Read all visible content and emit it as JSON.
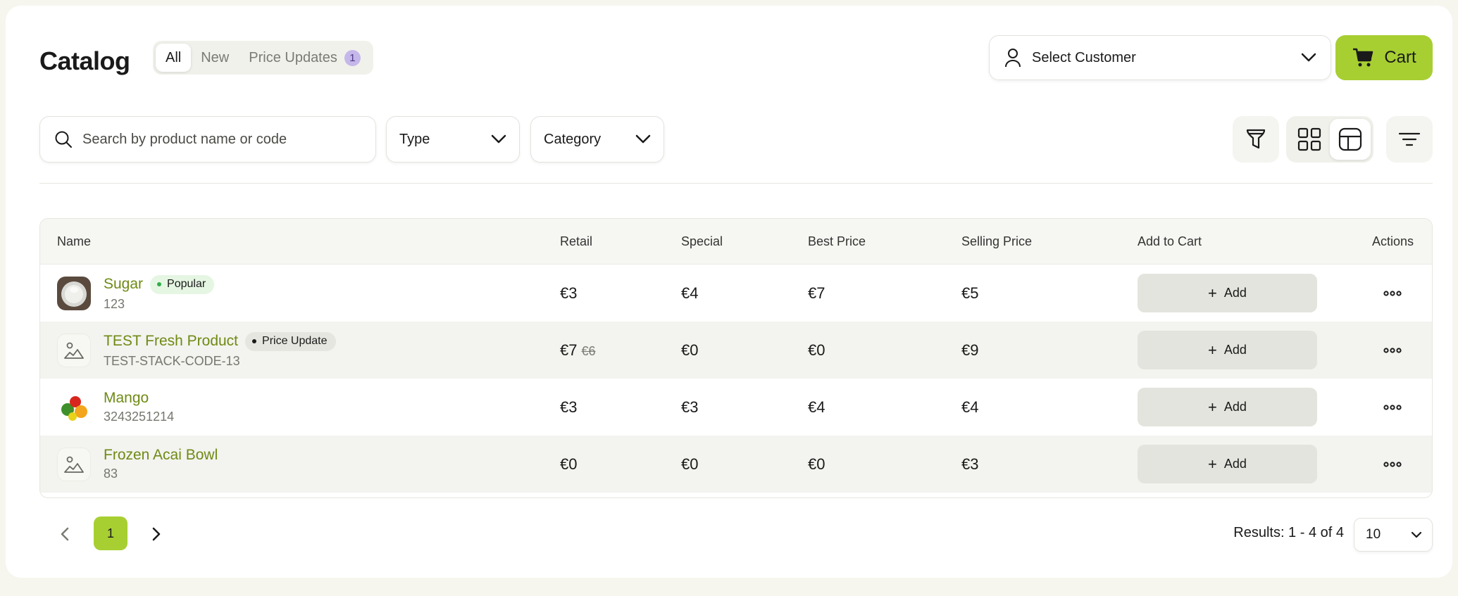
{
  "header": {
    "title": "Catalog",
    "tabs": [
      {
        "label": "All",
        "active": true
      },
      {
        "label": "New"
      },
      {
        "label": "Price Updates",
        "badge": "1"
      }
    ],
    "customer_label": "Select Customer",
    "cart_label": "Cart"
  },
  "filters": {
    "search_placeholder": "Search by product name or code",
    "type_label": "Type",
    "category_label": "Category"
  },
  "table": {
    "headers": [
      "Name",
      "Retail",
      "Special",
      "Best Price",
      "Selling Price",
      "Add to Cart",
      "Actions"
    ],
    "add_label": "Add",
    "rows": [
      {
        "name": "Sugar",
        "code": "123",
        "tag": "Popular",
        "retail": "€3",
        "retail_old": "",
        "special": "€4",
        "best": "€7",
        "selling": "€5"
      },
      {
        "name": "TEST Fresh Product",
        "code": "TEST-STACK-CODE-13",
        "tag": "Price Update",
        "retail": "€7",
        "retail_old": "€6",
        "special": "€0",
        "best": "€0",
        "selling": "€9"
      },
      {
        "name": "Mango",
        "code": "3243251214",
        "tag": "",
        "retail": "€3",
        "retail_old": "",
        "special": "€3",
        "best": "€4",
        "selling": "€4"
      },
      {
        "name": "Frozen Acai Bowl",
        "code": "83",
        "tag": "",
        "retail": "€0",
        "retail_old": "",
        "special": "€0",
        "best": "€0",
        "selling": "€3"
      }
    ]
  },
  "pagination": {
    "current_page": "1",
    "results_text": "Results: 1 - 4 of 4",
    "per_page": "10"
  },
  "colors": {
    "accent": "#a7cf32",
    "product_link": "#6e8a14",
    "badge_purple": "#c5b7ea"
  }
}
